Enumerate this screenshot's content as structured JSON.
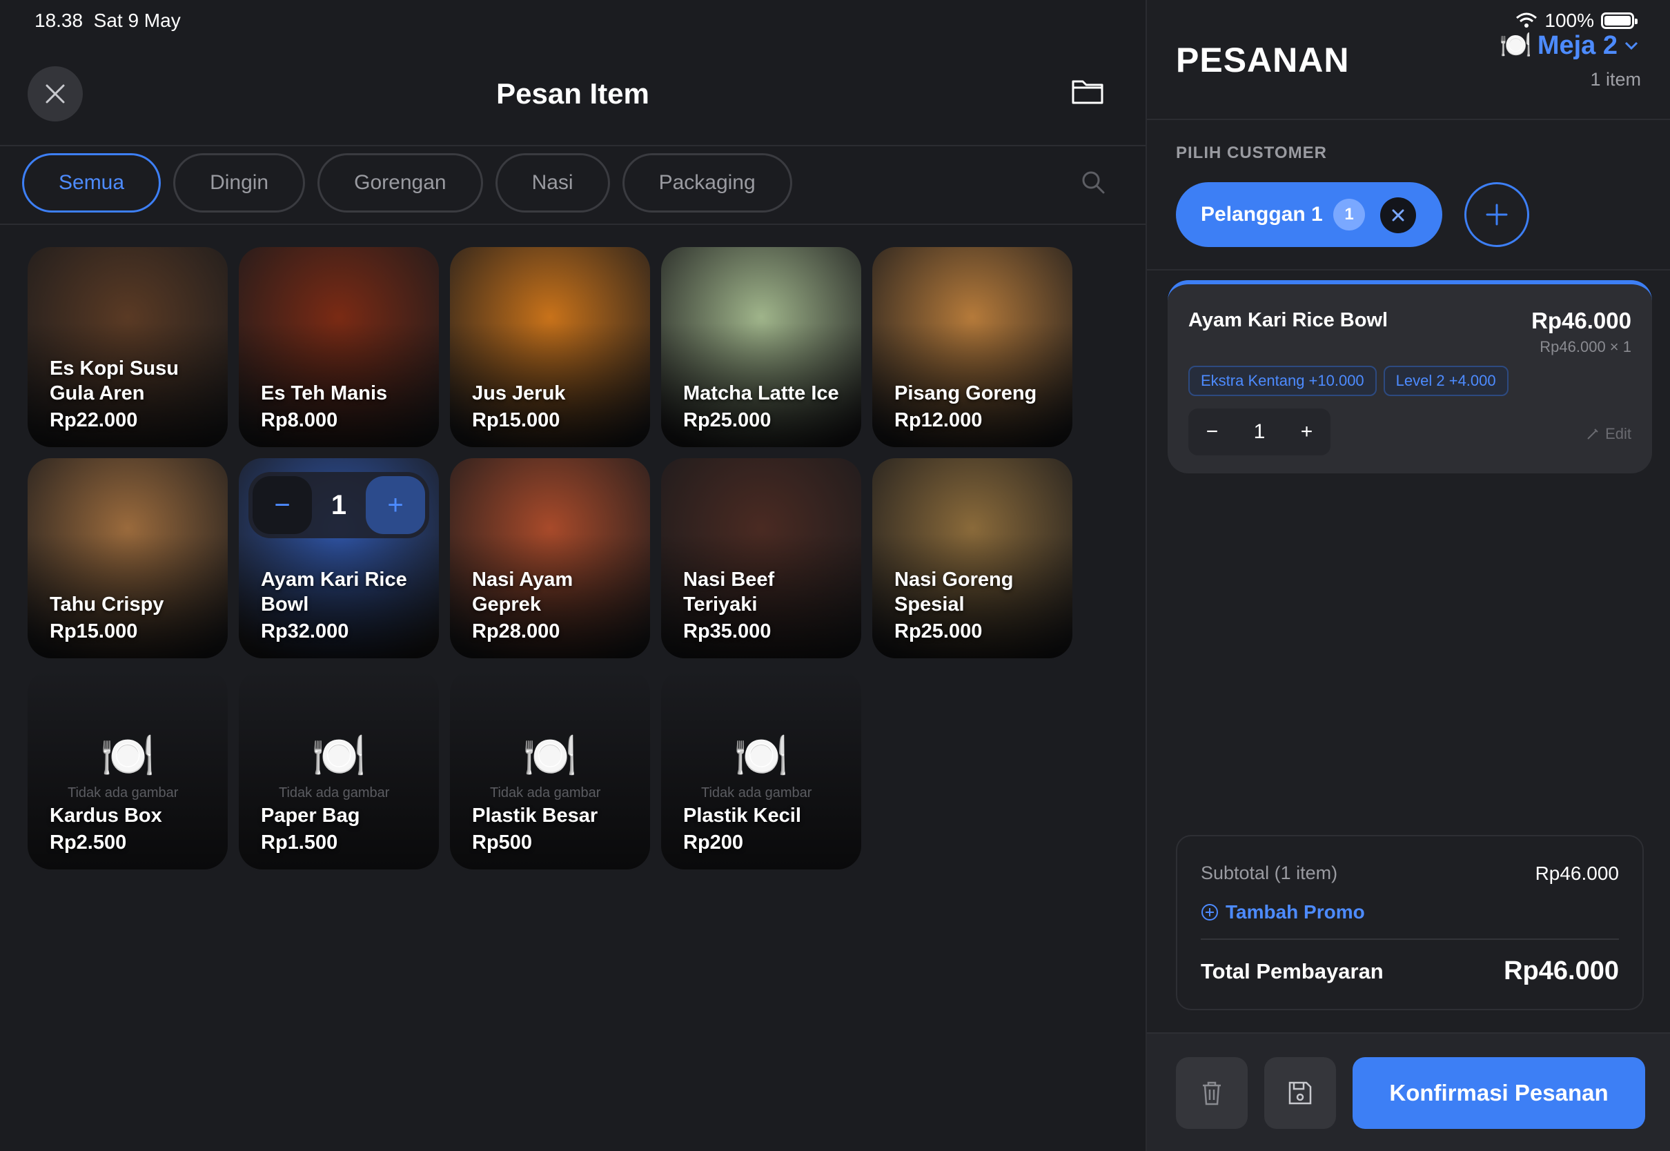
{
  "status": {
    "time": "18.38",
    "date": "Sat 9 May",
    "battery": "100%"
  },
  "header": {
    "title": "Pesan Item"
  },
  "categories": [
    {
      "label": "Semua",
      "active": true
    },
    {
      "label": "Dingin",
      "active": false
    },
    {
      "label": "Gorengan",
      "active": false
    },
    {
      "label": "Nasi",
      "active": false
    },
    {
      "label": "Packaging",
      "active": false
    }
  ],
  "products": [
    {
      "name": "Es Kopi Susu Gula Aren",
      "price": "Rp22.000",
      "bg": "#5a3a24"
    },
    {
      "name": "Es Teh Manis",
      "price": "Rp8.000",
      "bg": "#7a2a14"
    },
    {
      "name": "Jus Jeruk",
      "price": "Rp15.000",
      "bg": "#c8721a"
    },
    {
      "name": "Matcha Latte Ice",
      "price": "Rp25.000",
      "bg": "#9fb48a"
    },
    {
      "name": "Pisang Goreng",
      "price": "Rp12.000",
      "bg": "#b57a3a"
    },
    {
      "name": "Tahu Crispy",
      "price": "Rp15.000",
      "bg": "#9a6a3c"
    },
    {
      "name": "Ayam Kari Rice Bowl",
      "price": "Rp32.000",
      "bg": "#2f55a8",
      "qty": "1"
    },
    {
      "name": "Nasi Ayam Geprek",
      "price": "Rp28.000",
      "bg": "#a84a2a"
    },
    {
      "name": "Nasi Beef Teriyaki",
      "price": "Rp35.000",
      "bg": "#4a2a22"
    },
    {
      "name": "Nasi Goreng Spesial",
      "price": "Rp25.000",
      "bg": "#8a6a3a"
    },
    {
      "name": "Kardus Box",
      "price": "Rp2.500",
      "noimg": true
    },
    {
      "name": "Paper Bag",
      "price": "Rp1.500",
      "noimg": true
    },
    {
      "name": "Plastik Besar",
      "price": "Rp500",
      "noimg": true
    },
    {
      "name": "Plastik Kecil",
      "price": "Rp200",
      "noimg": true
    }
  ],
  "no_image_text": "Tidak ada gambar",
  "order": {
    "title": "PESANAN",
    "table": "Meja 2",
    "item_count": "1 item",
    "customer_label": "PILIH CUSTOMER",
    "customer": {
      "name": "Pelanggan 1",
      "badge": "1"
    },
    "line": {
      "name": "Ayam Kari Rice Bowl",
      "price": "Rp46.000",
      "unit": "Rp46.000 × 1",
      "tags": [
        "Ekstra Kentang +10.000",
        "Level 2 +4.000"
      ],
      "qty": "1",
      "edit": "Edit"
    },
    "subtotal_label": "Subtotal (1 item)",
    "subtotal": "Rp46.000",
    "promo": "Tambah Promo",
    "total_label": "Total Pembayaran",
    "total": "Rp46.000",
    "confirm": "Konfirmasi Pesanan"
  },
  "colors": {
    "accent": "#3d7ff5",
    "background": "#1b1c20"
  }
}
